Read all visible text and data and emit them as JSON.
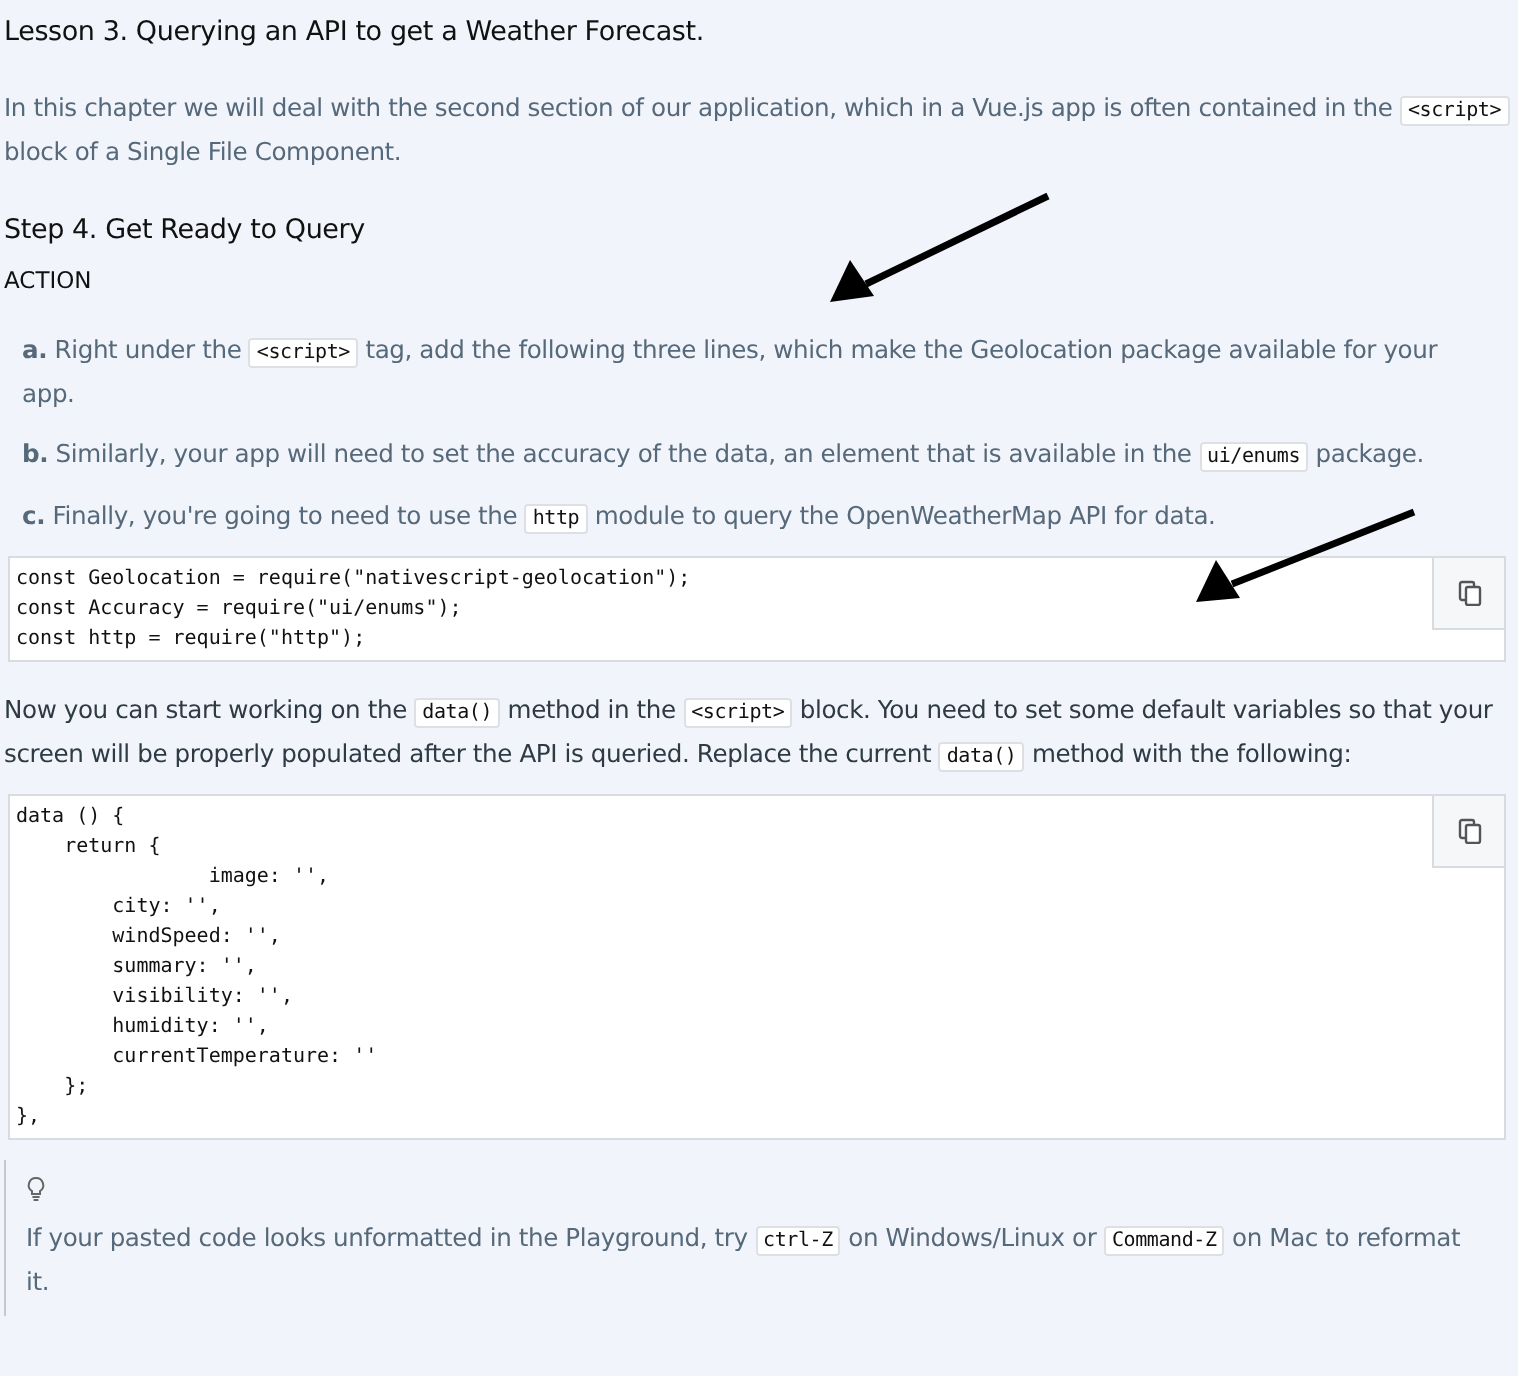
{
  "title": "Lesson 3. Querying an API to get a Weather Forecast.",
  "intro": [
    {
      "kind": "text",
      "text": "In this chapter we will deal with the second section of our application, which in a Vue.js app is often contained in the "
    },
    {
      "kind": "code",
      "text": "<script>"
    },
    {
      "kind": "text",
      "text": " block of a Single File Component."
    }
  ],
  "step_heading": "Step 4. Get Ready to Query",
  "action_label": "ACTION",
  "steps": [
    {
      "label": "a.",
      "segments": [
        {
          "kind": "text",
          "text": "Right under the "
        },
        {
          "kind": "code",
          "text": "<script>"
        },
        {
          "kind": "text",
          "text": " tag, add the following three lines, which make the Geolocation package available for your app."
        }
      ]
    },
    {
      "label": "b.",
      "segments": [
        {
          "kind": "text",
          "text": "Similarly, your app will need to set the accuracy of the data, an element that is available in the "
        },
        {
          "kind": "code",
          "text": "ui/enums"
        },
        {
          "kind": "text",
          "text": " package."
        }
      ]
    },
    {
      "label": "c.",
      "segments": [
        {
          "kind": "text",
          "text": "Finally, you're going to need to use the "
        },
        {
          "kind": "code",
          "text": "http"
        },
        {
          "kind": "text",
          "text": " module to query the OpenWeatherMap API for data."
        }
      ]
    }
  ],
  "code_block_1": [
    "const Geolocation = require(\"nativescript-geolocation\");",
    "const Accuracy = require(\"ui/enums\");",
    "const http = require(\"http\");"
  ],
  "paragraph": [
    {
      "kind": "text",
      "text": "Now you can start working on the "
    },
    {
      "kind": "code",
      "text": "data()"
    },
    {
      "kind": "text",
      "text": " method in the "
    },
    {
      "kind": "code",
      "text": "<script>"
    },
    {
      "kind": "text",
      "text": " block. You need to set some default variables so that your screen will be properly populated after the API is queried. Replace the current "
    },
    {
      "kind": "code",
      "text": "data()"
    },
    {
      "kind": "text",
      "text": " method with the following:"
    }
  ],
  "code_block_2": [
    "data () {",
    "    return {",
    "                image: '',",
    "        city: '',",
    "        windSpeed: '',",
    "        summary: '',",
    "        visibility: '',",
    "        humidity: '',",
    "        currentTemperature: ''",
    "    };",
    "},"
  ],
  "tip": [
    {
      "kind": "text",
      "text": "If your pasted code looks unformatted in the Playground, try "
    },
    {
      "kind": "code",
      "text": "ctrl-Z"
    },
    {
      "kind": "text",
      "text": " on Windows/Linux or "
    },
    {
      "kind": "code",
      "text": "Command-Z"
    },
    {
      "kind": "text",
      "text": " on Mac to reformat it."
    }
  ]
}
